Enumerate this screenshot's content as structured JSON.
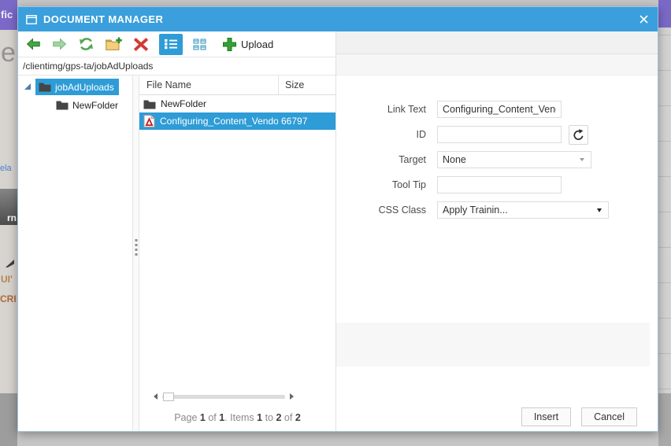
{
  "window": {
    "title": "DOCUMENT MANAGER"
  },
  "toolbar": {
    "upload_label": "Upload"
  },
  "breadcrumb": {
    "path": "/clientimg/gps-ta/jobAdUploads"
  },
  "tree": {
    "items": [
      {
        "label": "jobAdUploads",
        "selected": true
      },
      {
        "label": "NewFolder",
        "selected": false
      }
    ]
  },
  "grid": {
    "columns": {
      "name": "File Name",
      "size": "Size"
    },
    "rows": [
      {
        "name": "NewFolder",
        "size": "",
        "type": "folder",
        "selected": false
      },
      {
        "name": "Configuring_Content_Vendo",
        "size": "66797",
        "type": "pdf",
        "selected": true
      }
    ],
    "pager_parts": [
      "Page ",
      "1",
      " of ",
      "1",
      ". Items ",
      "1",
      " to ",
      "2",
      " of ",
      "2"
    ]
  },
  "form": {
    "link_text": {
      "label": "Link Text",
      "value": "Configuring_Content_Vendor"
    },
    "id": {
      "label": "ID",
      "value": ""
    },
    "target": {
      "label": "Target",
      "value": "None"
    },
    "tooltip": {
      "label": "Tool Tip",
      "value": ""
    },
    "css_class": {
      "label": "CSS Class",
      "value": "Apply Trainin..."
    }
  },
  "footer": {
    "insert_label": "Insert",
    "cancel_label": "Cancel"
  },
  "background": {
    "fragments": {
      "header": "fic",
      "letter": "e",
      "link": "ela",
      "badge": "rn",
      "ui": "UI'",
      "cri": "CRI"
    }
  },
  "colors": {
    "titlebar": "#3A9FDC",
    "selection": "#2E9CD6",
    "purple": "#7B69C8"
  }
}
